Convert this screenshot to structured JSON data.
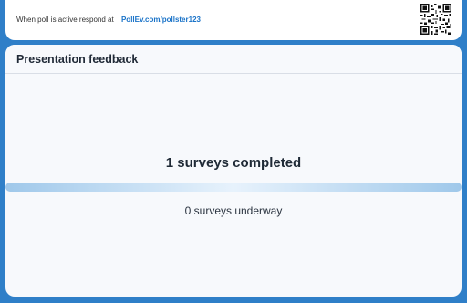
{
  "header": {
    "respond_text": "When poll is active respond at",
    "respond_url": "PollEv.com/pollster123"
  },
  "main": {
    "title": "Presentation feedback",
    "completed_text": "1 surveys completed",
    "completed_count": 1,
    "underway_text": "0 surveys underway",
    "underway_count": 0
  },
  "icons": {
    "qr": "qr-code-icon"
  },
  "colors": {
    "background": "#2f7fc8",
    "link": "#1a73c8",
    "progress_edge": "#9fc8ea",
    "progress_center": "#e7f2fc"
  }
}
